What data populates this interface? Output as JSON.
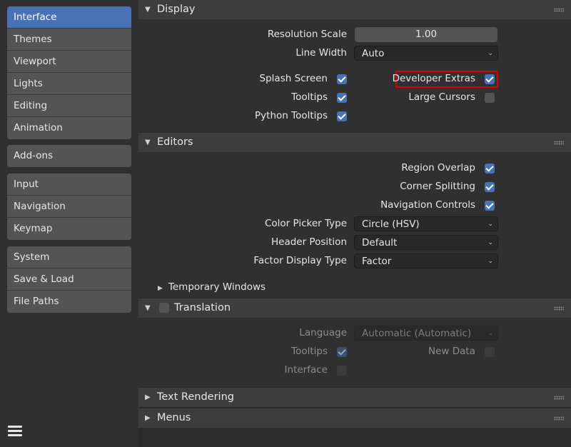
{
  "sidebar": {
    "groups": [
      [
        "Interface",
        "Themes",
        "Viewport",
        "Lights",
        "Editing",
        "Animation"
      ],
      [
        "Add-ons"
      ],
      [
        "Input",
        "Navigation",
        "Keymap"
      ],
      [
        "System",
        "Save & Load",
        "File Paths"
      ]
    ],
    "active": "Interface"
  },
  "display": {
    "title": "Display",
    "resolution_scale_label": "Resolution Scale",
    "resolution_scale_value": "1.00",
    "line_width_label": "Line Width",
    "line_width_value": "Auto",
    "splash_screen_label": "Splash Screen",
    "splash_screen_checked": true,
    "tooltips_label": "Tooltips",
    "tooltips_checked": true,
    "python_tooltips_label": "Python Tooltips",
    "python_tooltips_checked": true,
    "developer_extras_label": "Developer Extras",
    "developer_extras_checked": true,
    "large_cursors_label": "Large Cursors",
    "large_cursors_checked": false
  },
  "editors": {
    "title": "Editors",
    "region_overlap_label": "Region Overlap",
    "corner_splitting_label": "Corner Splitting",
    "navigation_controls_label": "Navigation Controls",
    "color_picker_type_label": "Color Picker Type",
    "color_picker_type_value": "Circle (HSV)",
    "header_position_label": "Header Position",
    "header_position_value": "Default",
    "factor_display_type_label": "Factor Display Type",
    "factor_display_type_value": "Factor",
    "temporary_windows_label": "Temporary Windows"
  },
  "translation": {
    "title": "Translation",
    "enabled": false,
    "language_label": "Language",
    "language_value": "Automatic (Automatic)",
    "tooltips_label": "Tooltips",
    "tooltips_checked": true,
    "new_data_label": "New Data",
    "new_data_checked": false,
    "interface_label": "Interface",
    "interface_checked": false
  },
  "text_rendering": {
    "title": "Text Rendering"
  },
  "menus": {
    "title": "Menus"
  },
  "colors": {
    "accent": "#4772b3",
    "highlight_box": "#e00000",
    "background": "#303030"
  }
}
